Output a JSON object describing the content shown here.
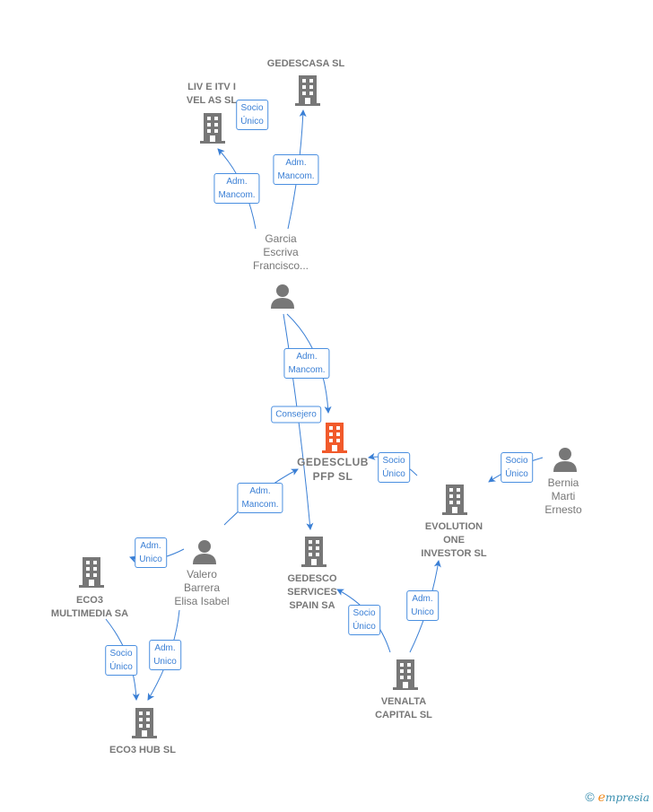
{
  "colors": {
    "entity": "#777777",
    "focus": "#f15a2b",
    "edge": "#3a7fd5"
  },
  "nodes": [
    {
      "id": "gedescasa",
      "type": "company",
      "label": "GEDESCASA SL"
    },
    {
      "id": "liv",
      "type": "company",
      "label": "LIV E ITV I\nVEL AS SL"
    },
    {
      "id": "garcia",
      "type": "person",
      "label": "Garcia\nEscriva\nFrancisco..."
    },
    {
      "id": "gedesclub",
      "type": "company-focus",
      "label": "GEDESCLUB\nPFP  SL"
    },
    {
      "id": "bernia",
      "type": "person",
      "label": "Bernia\nMarti\nErnesto"
    },
    {
      "id": "evolution",
      "type": "company",
      "label": "EVOLUTION\nONE\nINVESTOR  SL"
    },
    {
      "id": "valero",
      "type": "person",
      "label": "Valero\nBarrera\nElisa Isabel"
    },
    {
      "id": "eco3multi",
      "type": "company",
      "label": "ECO3\nMULTIMEDIA SA"
    },
    {
      "id": "gedesco",
      "type": "company",
      "label": "GEDESCO\nSERVICES\nSPAIN SA"
    },
    {
      "id": "eco3hub",
      "type": "company",
      "label": "ECO3 HUB  SL"
    },
    {
      "id": "venalta",
      "type": "company",
      "label": "VENALTA\nCAPITAL  SL"
    }
  ],
  "edge_labels": [
    {
      "from": "gedescasa",
      "to": "liv",
      "label": "Socio\nÚnico"
    },
    {
      "from": "garcia",
      "to": "gedescasa",
      "label": "Adm.\nMancom."
    },
    {
      "from": "garcia",
      "to": "liv",
      "label": "Adm.\nMancom."
    },
    {
      "from": "garcia",
      "to": "gedesclub",
      "label": "Adm.\nMancom."
    },
    {
      "from": "garcia",
      "to": "gedesco",
      "label": "Consejero"
    },
    {
      "from": "evolution",
      "to": "gedesclub",
      "label": "Socio\nÚnico"
    },
    {
      "from": "bernia",
      "to": "evolution",
      "label": "Socio\nÚnico"
    },
    {
      "from": "valero",
      "to": "gedesclub",
      "label": "Adm.\nMancom."
    },
    {
      "from": "valero",
      "to": "eco3multi",
      "label": "Adm.\nUnico"
    },
    {
      "from": "venalta",
      "to": "gedesco",
      "label": "Socio\nÚnico"
    },
    {
      "from": "venalta",
      "to": "evolution",
      "label": "Adm.\nUnico"
    },
    {
      "from": "eco3multi",
      "to": "eco3hub",
      "label": "Socio\nÚnico"
    },
    {
      "from": "valero",
      "to": "eco3hub",
      "label": "Adm.\nUnico"
    }
  ],
  "footer": {
    "copyright": "©",
    "brand_initial": "e",
    "brand_rest": "mpresia"
  }
}
